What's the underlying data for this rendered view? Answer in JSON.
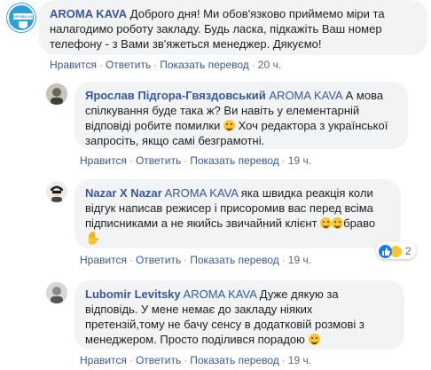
{
  "actions": {
    "like": "Нравится",
    "reply": "Ответить",
    "translate": "Показать перевод",
    "sep": "·"
  },
  "comments": [
    {
      "author": "AROMA KAVA",
      "avatar_text": "AROMA KAVA",
      "text": "Доброго дня! Ми обов'язково приймемо міри та налагодимо роботу закладу. Будь ласка, підкажіть Ваш номер телефону - з Вами зв'яжеться менеджер. Дякуємо!",
      "time": "20 ч."
    },
    {
      "author": "Ярослав Підгора-Гвяздовський",
      "tag": "AROMA KAVA",
      "text_a": "А мова спілкування буде така ж? Ви навіть у елементарній відповіді робите помилки",
      "text_b": "Хоч редактора з української запросіть, якщо самі безграмотні.",
      "time": "19 ч."
    },
    {
      "author": "Nazar X Nazar",
      "tag": "AROMA KAVA",
      "text_a": "яка швидка реакція коли відгук написав режисер і присоромив вас перед всіма підписниками а не якийсь звичайний клієнт",
      "text_b": "браво",
      "time": "19 ч.",
      "reaction_count": "2"
    },
    {
      "author": "Lubomir Levitsky",
      "tag": "AROMA KAVA",
      "text_a": "Дуже дякую за відповідь. У мене немає до закладу ніяких претензій,тому не бачу сенсу в додатковій розмові з менеджером. Просто поділився порадою",
      "time": "19 ч."
    }
  ],
  "colors": {
    "link": "#385898",
    "bubble": "#f2f3f5",
    "meta": "#606770",
    "like_blue": "#1877f2",
    "love_red": "#f33e58"
  }
}
